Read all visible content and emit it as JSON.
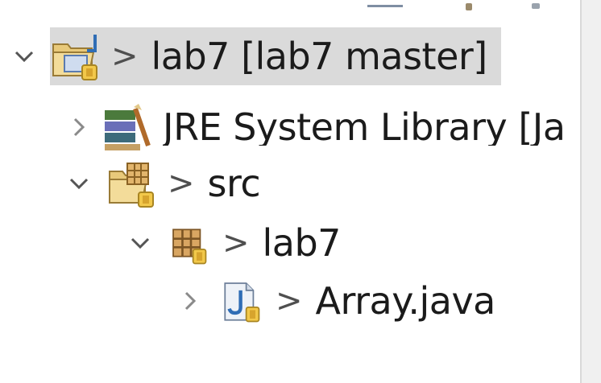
{
  "tree": {
    "nodes": [
      {
        "prefix": ">",
        "label": "lab7 [lab7 master]",
        "expanded": true,
        "selected": true,
        "icon": "git-java-project-icon"
      },
      {
        "prefix": "",
        "label": "JRE System Library [Ja",
        "expanded": false,
        "selected": false,
        "icon": "library-icon"
      },
      {
        "prefix": ">",
        "label": "src",
        "expanded": true,
        "selected": false,
        "icon": "source-folder-icon"
      },
      {
        "prefix": ">",
        "label": "lab7",
        "expanded": true,
        "selected": false,
        "icon": "package-icon"
      },
      {
        "prefix": ">",
        "label": "Array.java",
        "expanded": false,
        "selected": false,
        "icon": "java-file-icon"
      }
    ]
  },
  "colors": {
    "selection": "#dadada",
    "chevron": "#555555",
    "text": "#1b1b1b"
  }
}
